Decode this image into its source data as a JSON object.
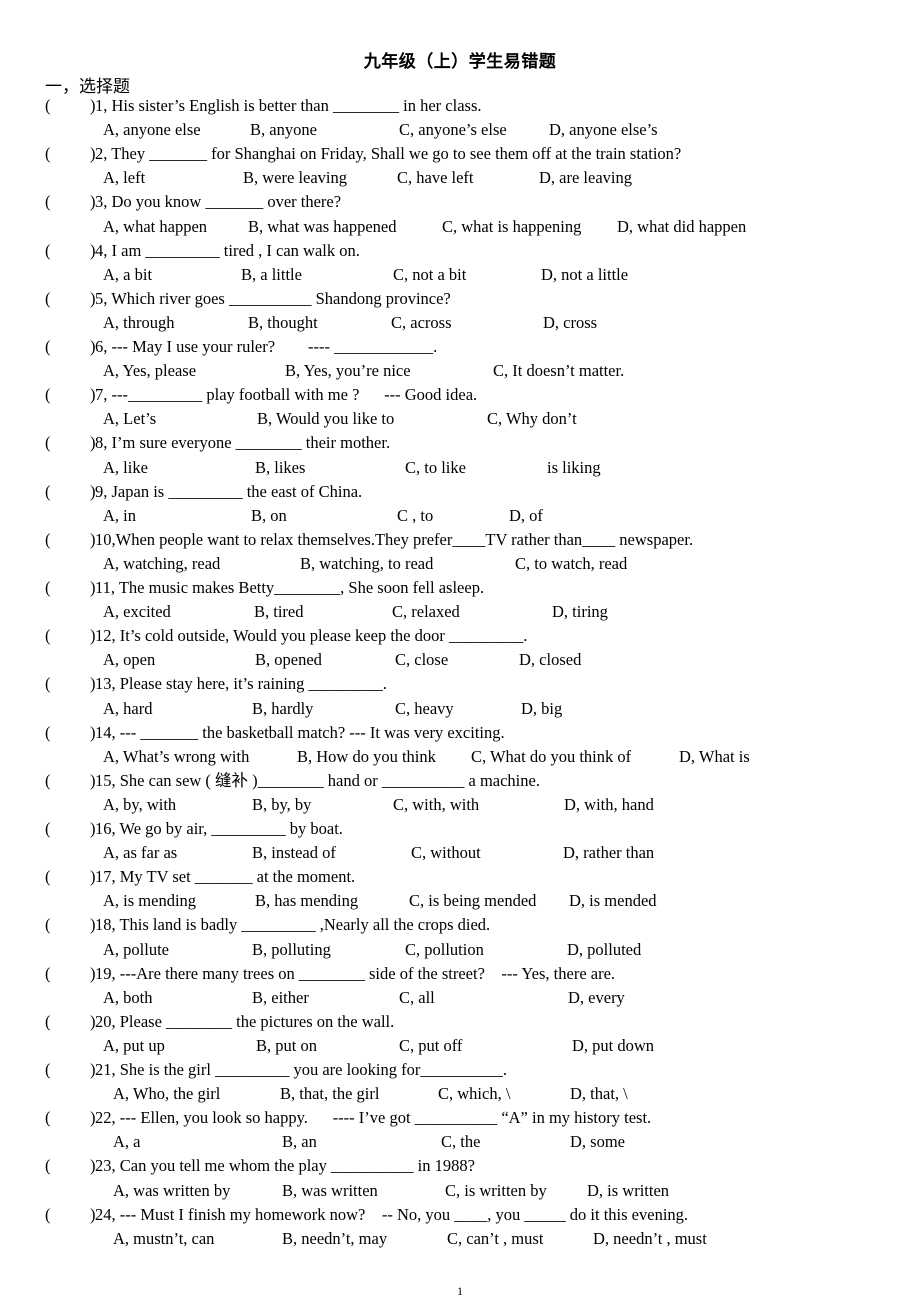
{
  "title": "九年级（上）学生易错题",
  "section": "一，选择题",
  "questions": [
    {
      "stem": "1, His sister’s English is better than ________ in her class.",
      "options": [
        "A, anyone else",
        "B, anyone",
        "C, anyone’s else",
        "D, anyone else’s"
      ]
    },
    {
      "stem": "2, They _______ for Shanghai on Friday, Shall we go to see them off at the train station?",
      "options": [
        "A, left",
        "B, were leaving",
        "C, have left",
        "D, are leaving"
      ]
    },
    {
      "stem": "3, Do you know _______ over there?",
      "options": [
        "A, what happen",
        "B, what was happened",
        "C, what is happening",
        "D, what did happen"
      ]
    },
    {
      "stem": "4, I am _________ tired , I can walk on.",
      "options": [
        "A, a bit",
        "B, a little",
        "C, not a bit",
        "D, not a little"
      ]
    },
    {
      "stem": "5, Which river goes __________ Shandong province?",
      "options": [
        "A, through",
        "B, thought",
        "C, across",
        "D, cross"
      ]
    },
    {
      "stem": "6, --- May I use your ruler?        ---- ____________.",
      "options": [
        "A, Yes, please",
        "B, Yes, you’re nice",
        "C, It doesn’t matter."
      ]
    },
    {
      "stem": "7, ---_________ play football with me ?      --- Good idea.",
      "options": [
        "A, Let’s",
        "B, Would you like to",
        "C, Why don’t"
      ]
    },
    {
      "stem": "8, I’m sure everyone ________ their mother.",
      "options": [
        "A, like",
        "B, likes",
        "C, to like",
        "is liking"
      ]
    },
    {
      "stem": "9, Japan is _________ the east of China.",
      "options": [
        "A, in",
        "B, on",
        "C , to",
        "D, of"
      ]
    },
    {
      "stem": "10,When people want to relax themselves.They prefer____TV rather than____ newspaper.",
      "options": [
        "A, watching, read",
        "B, watching, to read",
        "C, to watch, read"
      ]
    },
    {
      "stem": "11, The music makes Betty________, She soon fell asleep.",
      "options": [
        "A, excited",
        "B, tired",
        "C, relaxed",
        "D, tiring"
      ]
    },
    {
      "stem": "12, It’s cold outside, Would you please keep the door _________.",
      "options": [
        "A, open",
        "B, opened",
        "C, close",
        "D, closed"
      ]
    },
    {
      "stem": "13, Please stay here, it’s raining _________.",
      "options": [
        "A, hard",
        "B, hardly",
        "C, heavy",
        "D, big"
      ]
    },
    {
      "stem": "14, --- _______ the basketball match? --- It was very exciting.",
      "options": [
        "A, What’s wrong with",
        "B, How do you think",
        "C, What do you think of",
        "D, What is"
      ]
    },
    {
      "stem": "15, She can sew ( 缝补 )________ hand or __________ a machine.",
      "options": [
        "A, by, with",
        "B, by, by",
        "C, with, with",
        "D, with, hand"
      ]
    },
    {
      "stem": "16, We go by air, _________ by boat.",
      "options": [
        "A, as far as",
        "B, instead of",
        "C, without",
        "D, rather than"
      ]
    },
    {
      "stem": "17, My TV set _______ at the moment.",
      "options": [
        "A, is mending",
        "B, has mending",
        "C, is being mended",
        "D, is mended"
      ]
    },
    {
      "stem": "18, This land is badly _________ ,Nearly all the crops died.",
      "options": [
        "A, pollute",
        "B, polluting",
        "C, pollution",
        "D, polluted"
      ]
    },
    {
      "stem": "19, ---Are there many trees on ________ side of the street?    --- Yes, there are.",
      "options": [
        "A, both",
        "B, either",
        "C, all",
        "D, every"
      ]
    },
    {
      "stem": "20, Please ________ the pictures on the wall.",
      "options": [
        "A, put up",
        "B, put on",
        "C, put off",
        "D, put down"
      ]
    },
    {
      "stem": "21, She is the girl _________ you are looking for__________.",
      "options": [
        "A, Who, the girl",
        "B, that, the girl",
        "C, which, \\",
        "D, that, \\"
      ]
    },
    {
      "stem": "22, --- Ellen, you look so happy.      ---- I’ve got __________ “A” in my history test.",
      "options": [
        "A, a",
        "B, an",
        "C, the",
        "D, some"
      ]
    },
    {
      "stem": "23, Can you tell me whom the play __________ in 1988?",
      "options": [
        "A, was written by",
        "B, was written",
        "C, is written by",
        "D, is written"
      ]
    },
    {
      "stem": "24, --- Must I finish my homework now?    -- No, you ____, you _____ do it this evening.",
      "options": [
        "A, mustn’t, can",
        "B, needn’t, may",
        "C, can’t , must",
        "D, needn’t , must"
      ]
    }
  ],
  "page_number": "1"
}
